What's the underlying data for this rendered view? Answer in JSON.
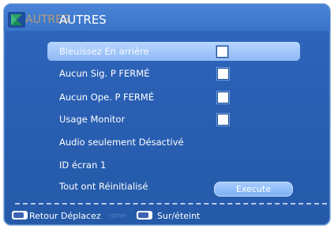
{
  "header": {
    "ghost_title": "AUTRES",
    "title": "AUTRES",
    "icon": "settings-menu-icon"
  },
  "menu": {
    "items": [
      {
        "label": "Bleuissez En arrière",
        "control": "checkbox",
        "checked": false,
        "selected": true
      },
      {
        "label": "Aucun Sig. P FERMÉ",
        "control": "checkbox",
        "checked": false
      },
      {
        "label": "Aucun Ope. P FERMÉ",
        "control": "checkbox",
        "checked": false
      },
      {
        "label": "Usage Monitor",
        "control": "checkbox",
        "checked": false
      },
      {
        "label": "Audio seulement  Désactivé"
      },
      {
        "label": "ID écran  1"
      },
      {
        "label": "Tout ont Réinitialisé"
      }
    ],
    "execute_label": "Execute"
  },
  "footer": {
    "back_label": "Retour",
    "move_label": "Déplacez",
    "ghost_label": "ntrer",
    "power_label": "Sur/éteint"
  },
  "colors": {
    "panel": "#2a5fb3",
    "highlight": "#9cc4fa",
    "text": "#ffffff"
  }
}
